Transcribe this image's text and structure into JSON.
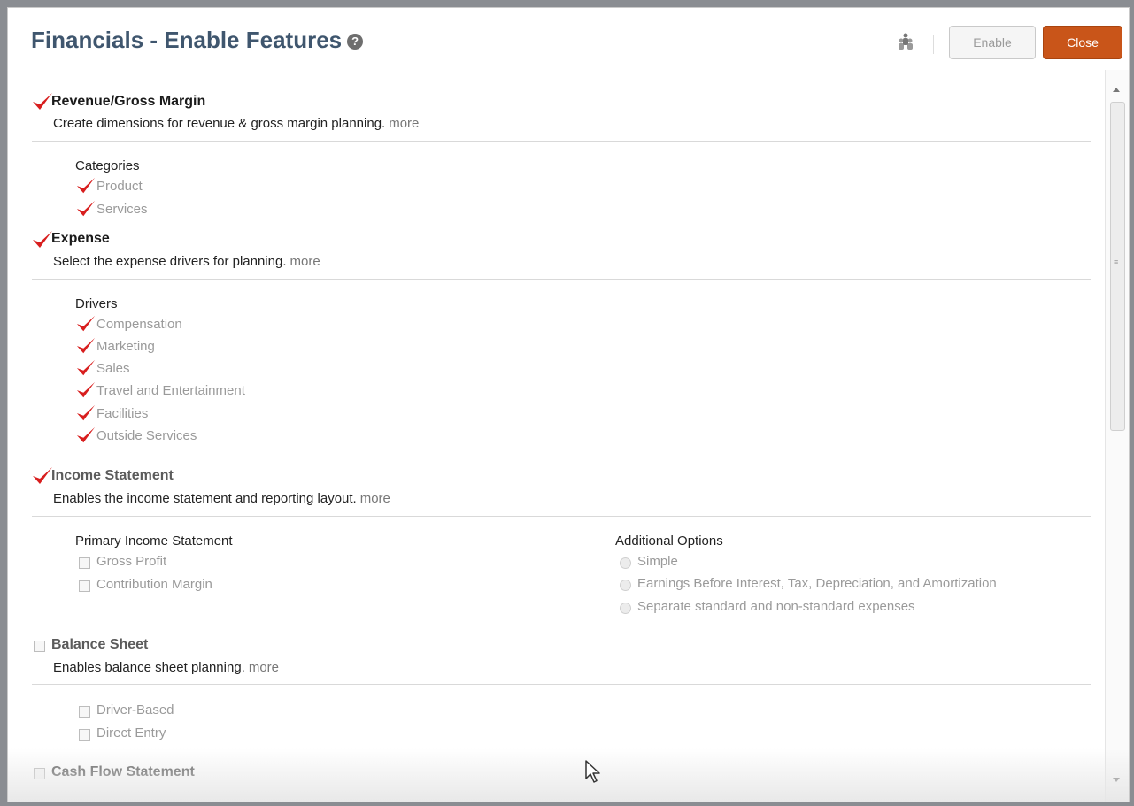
{
  "dialog": {
    "title": "Financials - Enable Features",
    "help_icon": "?",
    "enable_button": "Enable",
    "close_button": "Close"
  },
  "colors": {
    "title": "#3f566e",
    "close_button_bg": "#c95519",
    "checkmark": "#d81e1e"
  },
  "sections": {
    "revenue": {
      "title": "Revenue/Gross Margin",
      "checked": true,
      "description": "Create dimensions for revenue & gross margin planning.",
      "more": "more",
      "group_label": "Categories",
      "options": [
        {
          "label": "Product",
          "checked": true
        },
        {
          "label": "Services",
          "checked": true
        }
      ]
    },
    "expense": {
      "title": "Expense",
      "checked": true,
      "description": "Select the expense drivers for planning.",
      "more": "more",
      "group_label": "Drivers",
      "options": [
        {
          "label": "Compensation",
          "checked": true
        },
        {
          "label": "Marketing",
          "checked": true
        },
        {
          "label": "Sales",
          "checked": true
        },
        {
          "label": "Travel and Entertainment",
          "checked": true
        },
        {
          "label": "Facilities",
          "checked": true
        },
        {
          "label": "Outside Services",
          "checked": true
        }
      ]
    },
    "income": {
      "title": "Income Statement",
      "checked": true,
      "description": "Enables the income statement and reporting layout.",
      "more": "more",
      "primary_label": "Primary Income Statement",
      "primary_options": [
        {
          "label": "Gross Profit",
          "checked": false
        },
        {
          "label": "Contribution Margin",
          "checked": false
        }
      ],
      "additional_label": "Additional Options",
      "additional_options": [
        {
          "label": "Simple"
        },
        {
          "label": "Earnings Before Interest, Tax, Depreciation, and Amortization"
        },
        {
          "label": "Separate standard and non-standard expenses"
        }
      ]
    },
    "balance": {
      "title": "Balance Sheet",
      "checked": false,
      "description": "Enables balance sheet planning.",
      "more": "more",
      "options": [
        {
          "label": "Driver-Based",
          "checked": false
        },
        {
          "label": "Direct Entry",
          "checked": false
        }
      ]
    },
    "cashflow": {
      "title": "Cash Flow Statement",
      "checked": false
    }
  },
  "icons": {
    "help": "help-icon",
    "people": "people-icon",
    "check": "checkmark-icon",
    "cursor": "mouse-pointer-icon"
  }
}
